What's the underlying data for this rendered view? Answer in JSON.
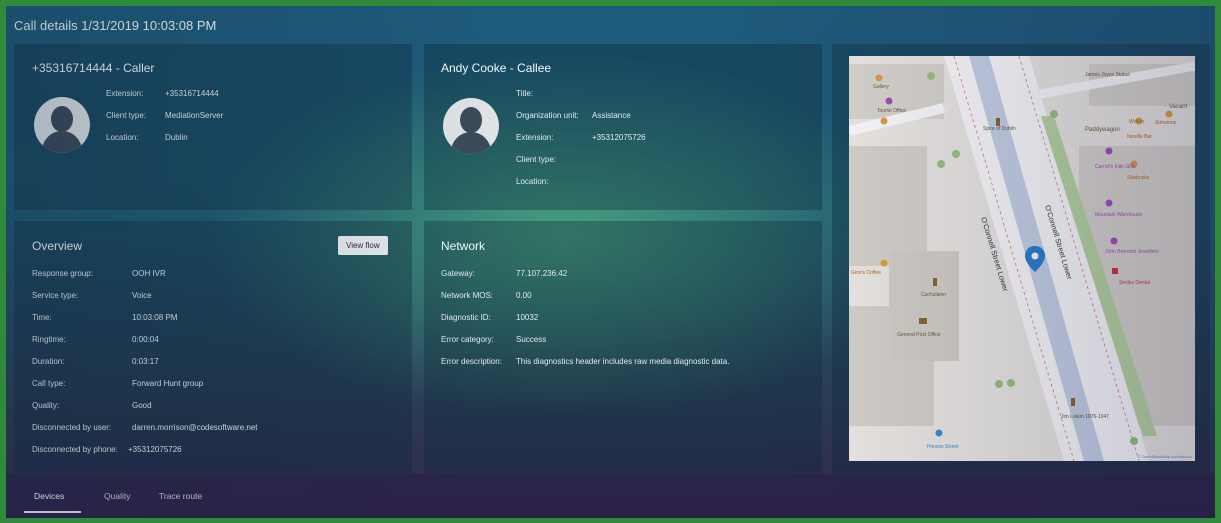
{
  "window": {
    "title": "Call details 1/31/2019 10:03:08 PM"
  },
  "caller": {
    "heading": "+35316714444 - Caller",
    "fields": [
      {
        "label": "Extension:",
        "value": "+35316714444"
      },
      {
        "label": "Client type:",
        "value": "MediationServer"
      },
      {
        "label": "Location:",
        "value": "Dublin"
      }
    ]
  },
  "callee": {
    "heading": "Andy Cooke - Callee",
    "fields": [
      {
        "label": "Title:",
        "value": ""
      },
      {
        "label": "Organization unit:",
        "value": "Assistance"
      },
      {
        "label": "Extension:",
        "value": "+35312075726"
      },
      {
        "label": "Client type:",
        "value": ""
      },
      {
        "label": "Location:",
        "value": ""
      }
    ]
  },
  "overview": {
    "heading": "Overview",
    "view_flow_label": "View flow",
    "fields": [
      {
        "label": "Response group:",
        "value": "OOH IVR"
      },
      {
        "label": "Service type:",
        "value": "Voice"
      },
      {
        "label": "Time:",
        "value": "10:03:08 PM"
      },
      {
        "label": "Ringtime:",
        "value": "0:00:04"
      },
      {
        "label": "Duration:",
        "value": "0:03:17"
      },
      {
        "label": "Call type:",
        "value": "Forward Hunt group"
      },
      {
        "label": "Quality:",
        "value": "Good"
      },
      {
        "label": "Disconnected by user:",
        "value": "darren.morrison@codesoftware.net"
      },
      {
        "label": "Disconnected by phone:",
        "value": "+35312075726"
      }
    ]
  },
  "network": {
    "heading": "Network",
    "fields": [
      {
        "label": "Gateway:",
        "value": "77.107.236.42"
      },
      {
        "label": "Network MOS:",
        "value": "0.00"
      },
      {
        "label": "Diagnostic ID:",
        "value": "10032"
      },
      {
        "label": "Error category:",
        "value": "Success"
      },
      {
        "label": "Error description:",
        "value": "This diagnostics header includes raw media diagnostic data."
      }
    ]
  },
  "map": {
    "labels": {
      "oconnell_1": "O'Connell Street Lower",
      "oconnell_2": "O'Connell Street Lower",
      "spire": "Spire of Dublin",
      "tourist": "Tourist Office",
      "gallery": "Gallery",
      "james": "James Joyce Statue",
      "vacant": "Vacant",
      "paddywagon": "Paddywagon",
      "wokin": "Wok in",
      "sohumi": "Sohumos",
      "noodle": "Noodle Bar",
      "carrolls": "Carroll's Irish Gifts",
      "starbucks": "Starbucks",
      "mountain": "Mountain Warehouse",
      "brereton": "John Brereton Jewellers",
      "smiles": "Smiles Dental",
      "cuchulainn": "Cuchulainn",
      "gpo": "General Post Office",
      "gino": "Gino's Coffee",
      "larkin": "Jim Larkin 1876-1947",
      "princes": "Princes Street",
      "attribution": "© OpenStreetMap contributors"
    },
    "colors": {
      "road": "#ffffff",
      "building": "#dcd8d0",
      "green_strip": "#b9d9a3",
      "pin": "#2a7fd0"
    }
  },
  "tabs": [
    {
      "label": "Devices",
      "active": true
    },
    {
      "label": "Quality",
      "active": false
    },
    {
      "label": "Trace route",
      "active": false
    }
  ]
}
